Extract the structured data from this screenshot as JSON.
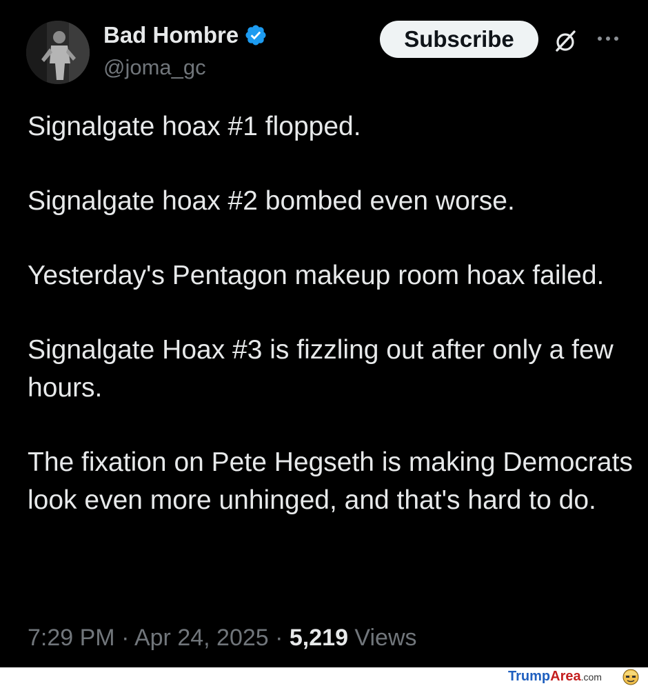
{
  "tweet": {
    "author": {
      "display_name": "Bad Hombre",
      "handle": "@joma_gc",
      "verified": true,
      "verified_color": "#1d9bf0"
    },
    "subscribe_label": "Subscribe",
    "icons": {
      "grok": "grok-icon",
      "more": "more-icon"
    },
    "paragraphs": [
      "Signalgate hoax #1 flopped.",
      "Signalgate hoax #2 bombed even worse.",
      "Yesterday's Pentagon makeup room hoax failed.",
      "Signalgate Hoax #3 is fizzling out after only a few hours.",
      "The fixation on Pete Hegseth is making Democrats look even more unhinged, and that's hard to do."
    ],
    "meta": {
      "time": "7:29 PM",
      "separator": " · ",
      "date": "Apr 24, 2025",
      "views_count": "5,219",
      "views_label": " Views"
    }
  },
  "watermark": {
    "part1": "Trump",
    "part2": "Area",
    "part3": ".com"
  },
  "colors": {
    "background": "#000000",
    "text": "#e7e9ea",
    "muted": "#71767b",
    "button_bg": "#eff3f4"
  }
}
